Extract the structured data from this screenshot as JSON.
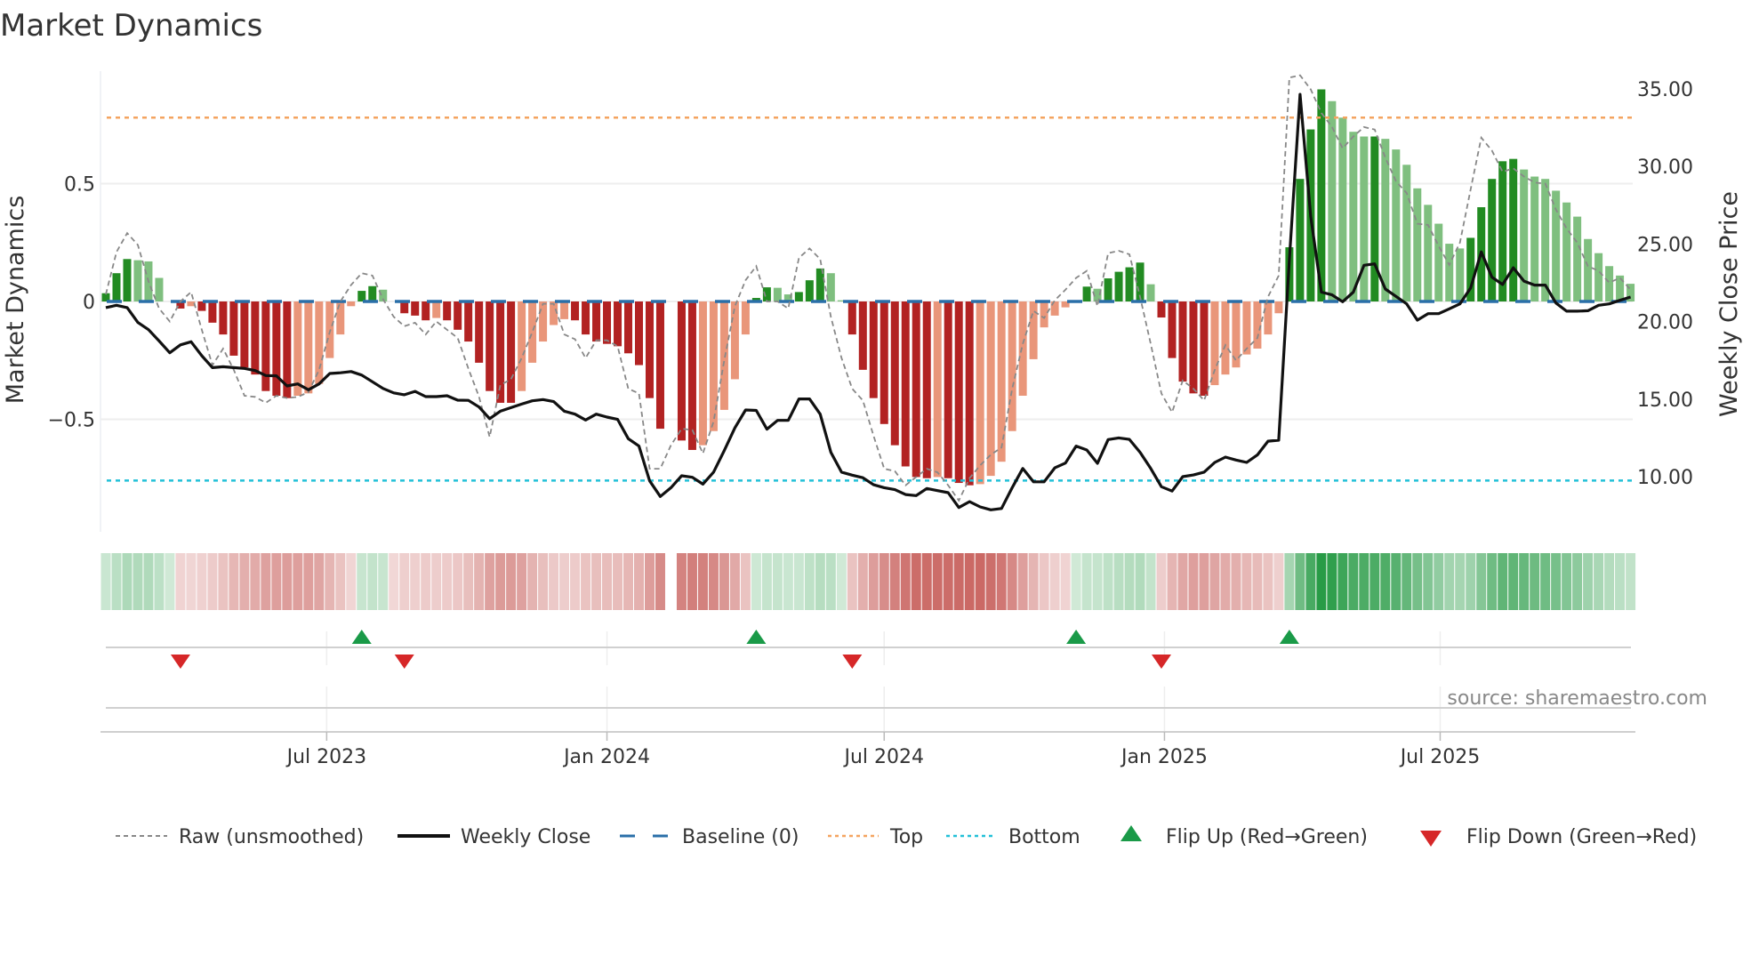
{
  "title": "Market Dynamics",
  "source": "source: sharemaestro.com",
  "legend": {
    "raw": "Raw (unsmoothed)",
    "close": "Weekly Close",
    "baseline": "Baseline (0)",
    "top": "Top",
    "bottom": "Bottom",
    "flip_up": "Flip Up (Red→Green)",
    "flip_down": "Flip Down (Green→Red)"
  },
  "colors": {
    "bar_up_strong": "#228b22",
    "bar_up_weak": "#7fbf7f",
    "bar_down_strong": "#b22222",
    "bar_down_weak": "#e9967a",
    "raw": "#888888",
    "close": "#111111",
    "baseline": "#2a6fa8",
    "top": "#f4a460",
    "bottom": "#22c0d8",
    "flip_up": "#1a9a48",
    "flip_down": "#d62728"
  },
  "chart_data": {
    "type": "bar",
    "title": "Market Dynamics",
    "ylabel": "Market Dynamics",
    "y2label": "Weekly Close Price",
    "ylim": [
      -0.98,
      0.97
    ],
    "y2lim": [
      7,
      37
    ],
    "yticks": [
      {
        "v": 0.5,
        "label": "0.5"
      },
      {
        "v": 0,
        "label": "0"
      },
      {
        "v": -0.5,
        "label": "−0.5"
      }
    ],
    "y2ticks": [
      {
        "v": 35,
        "label": "35.00"
      },
      {
        "v": 30,
        "label": "30.00"
      },
      {
        "v": 25,
        "label": "25.00"
      },
      {
        "v": 20,
        "label": "20.00"
      },
      {
        "v": 15,
        "label": "15.00"
      },
      {
        "v": 10,
        "label": "10.00"
      }
    ],
    "x_start": "2023-02-06",
    "x_step_days": 7,
    "xticks": [
      {
        "date": "2023-07-01",
        "label": "Jul 2023"
      },
      {
        "date": "2024-01-01",
        "label": "Jan 2024"
      },
      {
        "date": "2024-07-01",
        "label": "Jul 2024"
      },
      {
        "date": "2025-01-01",
        "label": "Jan 2025"
      },
      {
        "date": "2025-07-01",
        "label": "Jul 2025"
      }
    ],
    "top_level": 0.78,
    "bottom_level": -0.76,
    "baseline": 0,
    "momentum": [
      0.035,
      0.12,
      0.18,
      0.175,
      0.17,
      0.1,
      0,
      -0.03,
      -0.02,
      -0.04,
      -0.09,
      -0.14,
      -0.23,
      -0.28,
      -0.31,
      -0.38,
      -0.4,
      -0.41,
      -0.4,
      -0.39,
      -0.35,
      -0.24,
      -0.14,
      -0.02,
      0.045,
      0.065,
      0.05,
      0,
      -0.05,
      -0.06,
      -0.08,
      -0.07,
      -0.08,
      -0.12,
      -0.17,
      -0.26,
      -0.38,
      -0.43,
      -0.43,
      -0.38,
      -0.26,
      -0.17,
      -0.1,
      -0.075,
      -0.08,
      -0.14,
      -0.17,
      -0.18,
      -0.19,
      -0.22,
      -0.27,
      -0.41,
      -0.54,
      null,
      -0.59,
      -0.63,
      -0.61,
      -0.55,
      -0.46,
      -0.33,
      -0.14,
      0.015,
      0.06,
      0.058,
      0.03,
      0.04,
      0.09,
      0.14,
      0.12,
      0.005,
      -0.14,
      -0.29,
      -0.41,
      -0.52,
      -0.61,
      -0.7,
      -0.745,
      -0.75,
      -0.745,
      -0.75,
      -0.77,
      -0.78,
      -0.775,
      -0.74,
      -0.68,
      -0.55,
      -0.4,
      -0.245,
      -0.11,
      -0.06,
      -0.025,
      0,
      0.063,
      0.054,
      0.098,
      0.126,
      0.145,
      0.165,
      0.073,
      -0.068,
      -0.24,
      -0.34,
      -0.39,
      -0.4,
      -0.355,
      -0.31,
      -0.28,
      -0.225,
      -0.2,
      -0.14,
      -0.05,
      0.23,
      0.52,
      0.73,
      0.9,
      0.85,
      0.78,
      0.72,
      0.7,
      0.7,
      0.69,
      0.645,
      0.58,
      0.48,
      0.41,
      0.33,
      0.245,
      0.225,
      0.27,
      0.4,
      0.52,
      0.595,
      0.605,
      0.56,
      0.53,
      0.52,
      0.47,
      0.42,
      0.36,
      0.265,
      0.205,
      0.15,
      0.11,
      0.075
    ],
    "raw": [
      0.03,
      0.21,
      0.29,
      0.24,
      0.085,
      -0.03,
      -0.085,
      0.0,
      0.04,
      -0.12,
      -0.27,
      -0.2,
      -0.29,
      -0.4,
      -0.405,
      -0.43,
      -0.4,
      -0.41,
      -0.405,
      -0.385,
      -0.29,
      -0.13,
      0.0,
      0.07,
      0.12,
      0.11,
      0.01,
      -0.065,
      -0.105,
      -0.09,
      -0.14,
      -0.085,
      -0.12,
      -0.155,
      -0.285,
      -0.405,
      -0.575,
      -0.355,
      -0.33,
      -0.24,
      -0.13,
      -0.01,
      -0.01,
      -0.14,
      -0.16,
      -0.24,
      -0.165,
      -0.165,
      -0.19,
      -0.37,
      -0.39,
      -0.71,
      -0.71,
      -0.61,
      -0.54,
      -0.545,
      -0.645,
      -0.51,
      -0.25,
      -0.02,
      0.09,
      0.15,
      0.0,
      0.0,
      -0.03,
      0.185,
      0.225,
      0.18,
      -0.065,
      -0.24,
      -0.37,
      -0.42,
      -0.57,
      -0.71,
      -0.72,
      -0.78,
      -0.745,
      -0.71,
      -0.725,
      -0.78,
      -0.845,
      -0.75,
      -0.695,
      -0.65,
      -0.62,
      -0.37,
      -0.18,
      -0.04,
      -0.07,
      0.005,
      0.05,
      0.1,
      0.13,
      -0.02,
      0.205,
      0.215,
      0.2,
      0.02,
      -0.18,
      -0.39,
      -0.47,
      -0.335,
      -0.37,
      -0.42,
      -0.29,
      -0.185,
      -0.25,
      -0.2,
      -0.155,
      0.02,
      0.11,
      0.95,
      0.96,
      0.9,
      0.8,
      0.74,
      0.65,
      0.7,
      0.74,
      0.73,
      0.61,
      0.51,
      0.46,
      0.33,
      0.325,
      0.235,
      0.155,
      0.25,
      0.475,
      0.695,
      0.64,
      0.55,
      0.565,
      0.53,
      0.505,
      0.5,
      0.39,
      0.31,
      0.25,
      0.15,
      0.13,
      0.08,
      0.1,
      0.05
    ],
    "close": [
      20.9,
      21.05,
      20.9,
      19.94,
      19.48,
      18.75,
      17.99,
      18.5,
      18.7,
      17.8,
      17.03,
      17.09,
      17.03,
      16.98,
      16.84,
      16.52,
      16.5,
      15.85,
      15.98,
      15.6,
      15.98,
      16.65,
      16.7,
      16.78,
      16.55,
      16.12,
      15.69,
      15.4,
      15.28,
      15.5,
      15.16,
      15.16,
      15.22,
      14.93,
      14.92,
      14.49,
      13.74,
      14.22,
      14.45,
      14.68,
      14.89,
      14.97,
      14.84,
      14.22,
      14.03,
      13.65,
      14.03,
      13.84,
      13.69,
      12.45,
      11.97,
      9.73,
      8.72,
      9.29,
      10.06,
      9.96,
      9.52,
      10.29,
      11.68,
      13.15,
      14.3,
      14.27,
      13.06,
      13.63,
      13.63,
      15.01,
      15.01,
      14.03,
      11.57,
      10.29,
      10.1,
      9.93,
      9.48,
      9.29,
      9.16,
      8.85,
      8.78,
      9.24,
      9.1,
      8.97,
      8.01,
      8.39,
      8.05,
      7.86,
      7.95,
      9.29,
      10.53,
      9.67,
      9.67,
      10.57,
      10.88,
      11.97,
      11.72,
      10.86,
      12.39,
      12.5,
      12.4,
      11.57,
      10.53,
      9.35,
      9.07,
      10.0,
      10.11,
      10.29,
      10.92,
      11.26,
      11.07,
      10.92,
      11.4,
      12.29,
      12.35,
      24.0,
      34.65,
      26.78,
      21.9,
      21.72,
      21.28,
      21.9,
      23.63,
      23.72,
      22.1,
      21.62,
      21.14,
      20.09,
      20.51,
      20.51,
      20.82,
      21.14,
      22.16,
      24.49,
      22.86,
      22.39,
      23.47,
      22.61,
      22.35,
      22.35,
      21.2,
      20.67,
      20.67,
      20.7,
      21.05,
      21.14,
      21.37,
      21.58
    ],
    "flip_up_weeks": [
      24,
      61,
      91,
      111
    ],
    "flip_down_weeks": [
      7,
      28,
      70,
      99
    ]
  }
}
